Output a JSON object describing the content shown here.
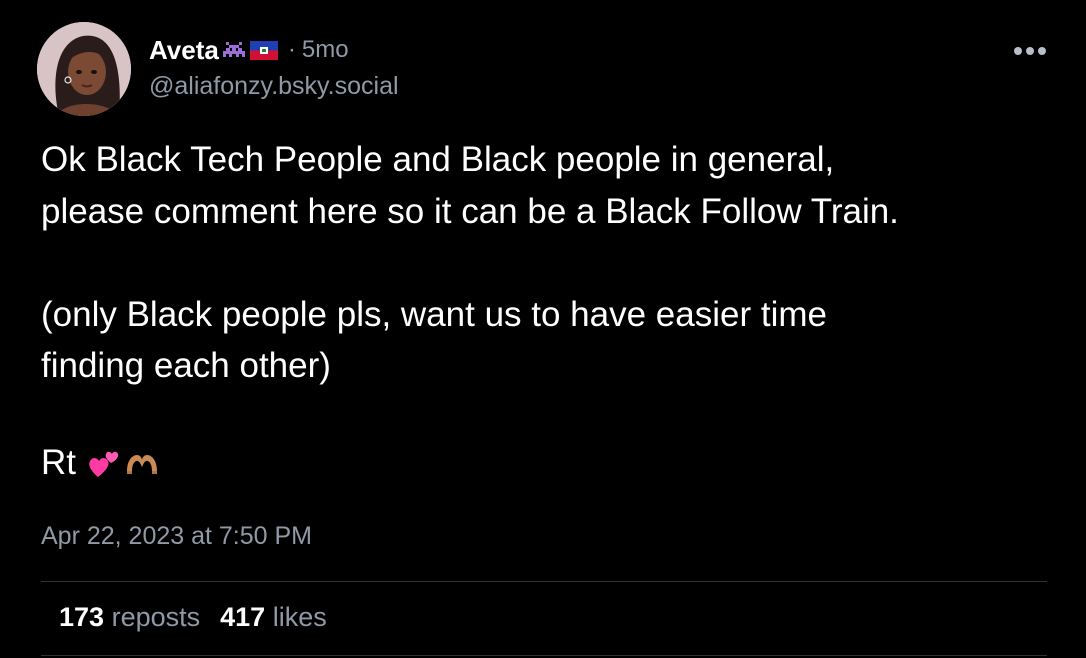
{
  "author": {
    "display_name": "Aveta",
    "badges": [
      "space-invader-emoji",
      "haiti-flag-emoji"
    ],
    "separator": "·",
    "age": "5mo",
    "handle": "@aliafonzy.bsky.social"
  },
  "post": {
    "text": "Ok Black Tech People and Black people in general,\nplease comment here so it can be a Black Follow Train.\n\n(only Black people pls, want us to have easier time\nfinding each other)",
    "rt_text": "Rt",
    "rt_emojis": [
      "two-hearts-emoji",
      "heart-hands-emoji"
    ],
    "timestamp": "Apr 22, 2023 at 7:50 PM"
  },
  "stats": {
    "reposts_count": "173",
    "reposts_label": "reposts",
    "likes_count": "417",
    "likes_label": "likes"
  },
  "menu": {
    "icon": "more-horizontal-icon"
  },
  "colors": {
    "background": "#000000",
    "primary_text": "#ffffff",
    "secondary_text": "#8f9aa6",
    "divider": "#2e3339"
  }
}
